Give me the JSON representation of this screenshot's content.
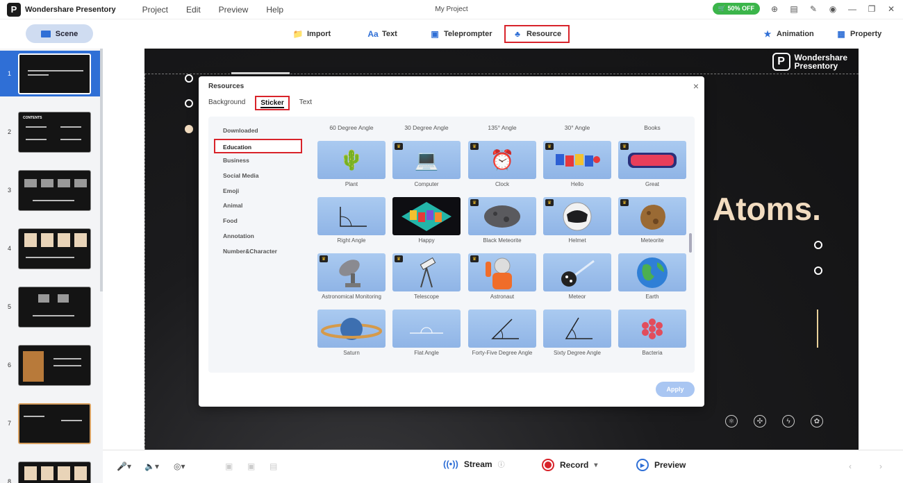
{
  "titlebar": {
    "app_name": "Wondershare Presentory",
    "menu": [
      "Project",
      "Edit",
      "Preview",
      "Help"
    ],
    "project_name": "My Project",
    "promo": "50% OFF"
  },
  "toolbar": {
    "scene": "Scene",
    "import": "Import",
    "text": "Text",
    "teleprompter": "Teleprompter",
    "resource": "Resource",
    "animation": "Animation",
    "property": "Property"
  },
  "slides": {
    "numbers": [
      "1",
      "2",
      "3",
      "4",
      "5",
      "6",
      "7",
      "8"
    ],
    "slide2_title": "CONTENTS"
  },
  "canvas": {
    "brand_line1": "Wondershare",
    "brand_line2": "Presentory",
    "headline": "Atoms."
  },
  "modal": {
    "title": "Resources",
    "close": "×",
    "tabs": [
      "Background",
      "Sticker",
      "Text"
    ],
    "categories": [
      "Downloaded",
      "Education",
      "Business",
      "Social Media",
      "Emoji",
      "Animal",
      "Food",
      "Annotation",
      "Number&Character"
    ],
    "column_heads": [
      "60 Degree Angle",
      "30 Degree Angle",
      "135° Angle",
      "30° Angle",
      "Books"
    ],
    "items": [
      [
        "Plant",
        "Computer",
        "Clock",
        "Hello",
        "Great"
      ],
      [
        "Right Angle",
        "Happy",
        "Black Meteorite",
        "Helmet",
        "Meteorite"
      ],
      [
        "Astronomical Monitoring",
        "Telescope",
        "Astronaut",
        "Meteor",
        "Earth"
      ],
      [
        "Saturn",
        "Flat Angle",
        "Forty-Five Degree Angle",
        "Sixty Degree Angle",
        "Bacteria"
      ]
    ],
    "apply": "Apply"
  },
  "bottombar": {
    "stream": "Stream",
    "record": "Record",
    "preview": "Preview"
  }
}
